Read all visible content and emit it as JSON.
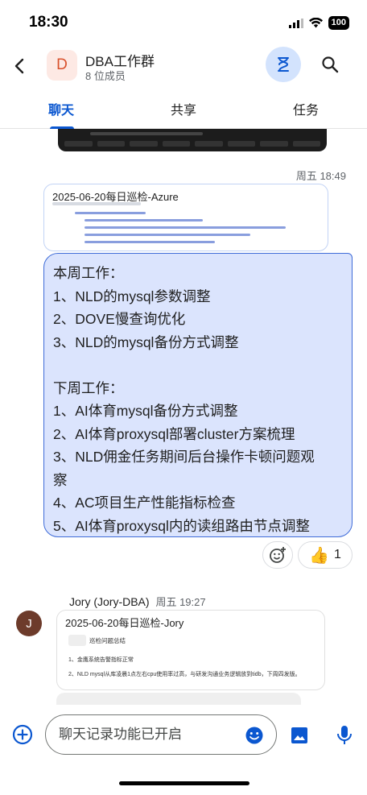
{
  "status_bar": {
    "time": "18:30",
    "battery": "100"
  },
  "header": {
    "avatar_letter": "D",
    "title": "DBA工作群",
    "subtitle": "8 位成员"
  },
  "tabs": [
    {
      "label": "聊天",
      "active": true
    },
    {
      "label": "共享",
      "active": false
    },
    {
      "label": "任务",
      "active": false
    }
  ],
  "messages": {
    "first_meta": "周五 18:49",
    "card1_title": "2025-06-20每日巡检-Azure",
    "bubble_lines": [
      "本周工作：",
      "1、NLD的mysql参数调整",
      "2、DOVE慢查询优化",
      "3、NLD的mysql备份方式调整",
      "",
      "下周工作：",
      "1、AI体育mysql备份方式调整",
      "2、AI体育proxysql部署cluster方案梳理",
      "3、NLD佣金任务期间后台操作卡顿问题观",
      "察",
      "4、AC项目生产性能指标检查",
      "5、AI体育proxysql内的读组路由节点调整"
    ],
    "reaction": {
      "emoji": "👍",
      "count": "1"
    },
    "second_sender": "Jory (Jory-DBA)",
    "second_time": "周五 19:27",
    "avatar_letter": "J",
    "card2_title": "2025-06-20每日巡检-Jory",
    "card2_heading": "巡检问题总结",
    "card2_items": [
      "1、金鹰系统告警指标正常",
      "2、NLD mysql从库凌晨1点左右cpu使用率过高，与研发沟通业务逻辑放到tidb，下周四发版。"
    ]
  },
  "input": {
    "placeholder": "聊天记录功能已开启"
  },
  "colors": {
    "accent": "#0b57d0",
    "bubble_bg": "#dbe4fd",
    "bubble_border": "#3f6cd8"
  }
}
